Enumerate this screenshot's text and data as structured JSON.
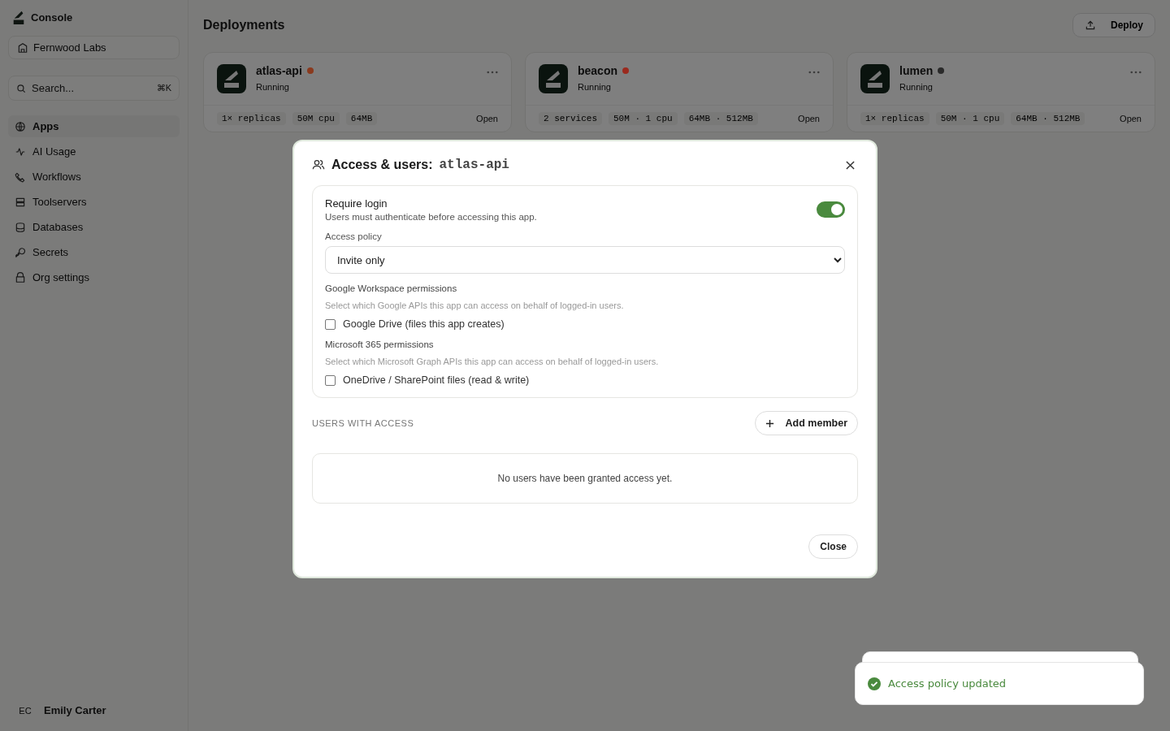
{
  "sidebar": {
    "brand": "Console",
    "org": "Fernwood Labs",
    "search": {
      "placeholder": "Search...",
      "shortcut": "⌘K"
    },
    "nav": [
      {
        "label": "Apps",
        "selected": true
      },
      {
        "label": "AI Usage",
        "selected": false
      },
      {
        "label": "Workflows",
        "selected": false
      },
      {
        "label": "Toolservers",
        "selected": false
      },
      {
        "label": "Databases",
        "selected": false
      },
      {
        "label": "Secrets",
        "selected": false
      },
      {
        "label": "Org settings",
        "selected": false
      }
    ],
    "user": {
      "initials": "EC",
      "name": "Emily Carter"
    }
  },
  "page": {
    "title": "Deployments",
    "deploy_button": "Deploy"
  },
  "apps": [
    {
      "name": "atlas-api",
      "color": "#8a3a1e",
      "status": "Running",
      "metrics": [
        "1× replicas",
        "50M cpu",
        "64MB"
      ],
      "open": "Open"
    },
    {
      "name": "beacon",
      "color": "#9a2a1e",
      "status": "Running",
      "metrics": [
        "2 services",
        "50M · 1 cpu",
        "64MB · 512MB"
      ],
      "open": "Open"
    },
    {
      "name": "lumen",
      "color": "#2a2a2a",
      "status": "Running",
      "metrics": [
        "1× replicas",
        "50M · 1 cpu",
        "64MB · 512MB"
      ],
      "open": "Open"
    }
  ],
  "dialog": {
    "title": "Access & users:",
    "app": "atlas-api",
    "require_login": {
      "label": "Require login",
      "description": "Users must authenticate before accessing this app.",
      "on": true
    },
    "policy": {
      "label": "Access policy",
      "value": "Invite only"
    },
    "permission_groups": [
      {
        "title": "Google Workspace permissions",
        "hint": "Select which Google APIs this app can access on behalf of logged-in users.",
        "options": [
          {
            "label": "Google Drive (files this app creates)",
            "checked": false
          }
        ]
      },
      {
        "title": "Microsoft 365 permissions",
        "hint": "Select which Microsoft Graph APIs this app can access on behalf of logged-in users.",
        "options": [
          {
            "label": "OneDrive / SharePoint files (read & write)",
            "checked": false
          }
        ]
      }
    ],
    "users": {
      "heading": "USERS WITH ACCESS",
      "add_button": "Add member",
      "empty": "No users have been granted access yet."
    },
    "close_button": "Close"
  },
  "toast": {
    "message": "Access policy updated"
  }
}
